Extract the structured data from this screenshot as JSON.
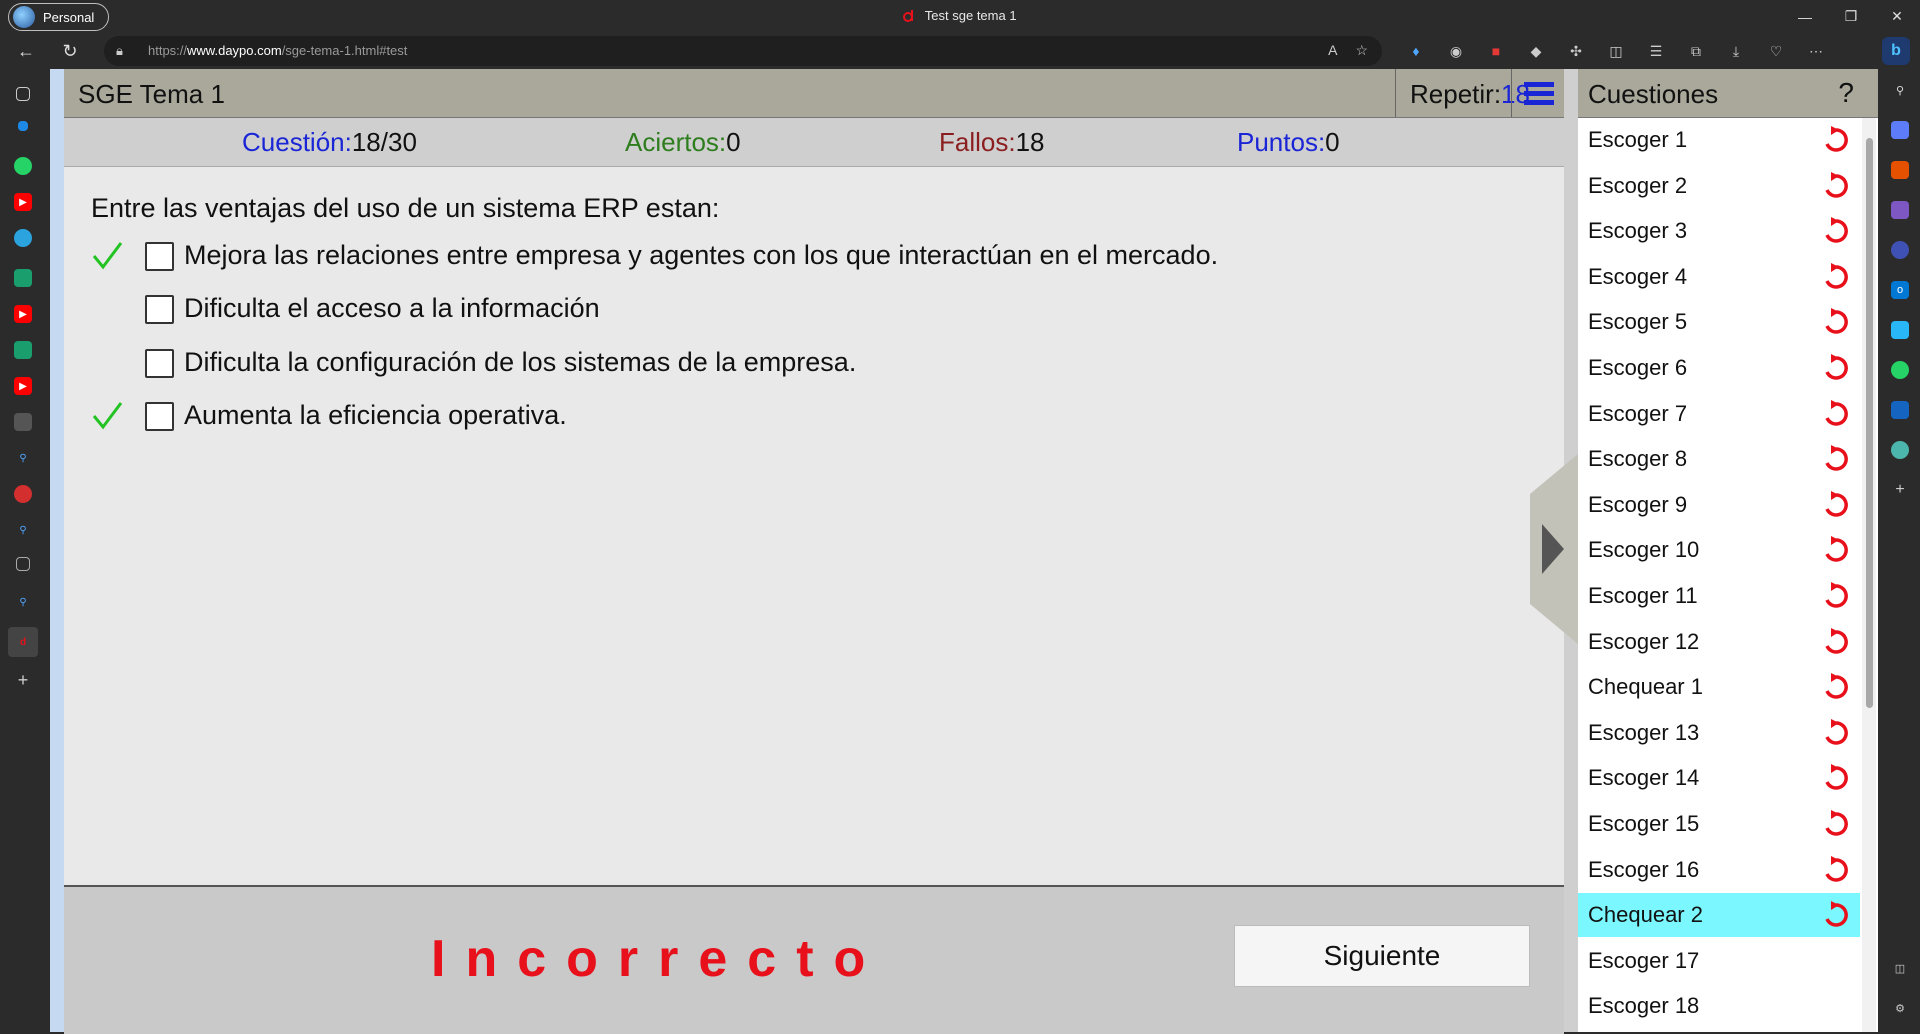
{
  "browser": {
    "profile_label": "Personal",
    "window_title": "Test sge tema 1",
    "url_prefix": "https://",
    "url_domain": "www.daypo.com",
    "url_path": "/sge-tema-1.html#test"
  },
  "header": {
    "title": "SGE Tema 1",
    "repeat_label": "Repetir:",
    "repeat_value": "18"
  },
  "stats": {
    "question_label": "Cuestión:",
    "question_value": "18/30",
    "correct_label": "Aciertos:",
    "correct_value": "0",
    "wrong_label": "Fallos:",
    "wrong_value": "18",
    "points_label": "Puntos:",
    "points_value": "0"
  },
  "question": {
    "text": "Entre las ventajas del uso de un sistema ERP estan:",
    "options": [
      {
        "text": "Mejora las relaciones entre empresa y agentes con los que interactúan en el mercado.",
        "correct_mark": true,
        "checked": false
      },
      {
        "text": "Dificulta el acceso a la información",
        "correct_mark": false,
        "checked": false
      },
      {
        "text": "Dificulta la configuración de los sistemas de la empresa.",
        "correct_mark": false,
        "checked": false
      },
      {
        "text": "Aumenta la eficiencia operativa.",
        "correct_mark": true,
        "checked": false
      }
    ]
  },
  "footer": {
    "result": "Incorrecto",
    "next_label": "Siguiente"
  },
  "questions_panel": {
    "title": "Cuestiones",
    "help": "?",
    "items": [
      {
        "label": "Escoger 1",
        "retry": true,
        "selected": false
      },
      {
        "label": "Escoger 2",
        "retry": true,
        "selected": false
      },
      {
        "label": "Escoger 3",
        "retry": true,
        "selected": false
      },
      {
        "label": "Escoger 4",
        "retry": true,
        "selected": false
      },
      {
        "label": "Escoger 5",
        "retry": true,
        "selected": false
      },
      {
        "label": "Escoger 6",
        "retry": true,
        "selected": false
      },
      {
        "label": "Escoger 7",
        "retry": true,
        "selected": false
      },
      {
        "label": "Escoger 8",
        "retry": true,
        "selected": false
      },
      {
        "label": "Escoger 9",
        "retry": true,
        "selected": false
      },
      {
        "label": "Escoger 10",
        "retry": true,
        "selected": false
      },
      {
        "label": "Escoger 11",
        "retry": true,
        "selected": false
      },
      {
        "label": "Escoger 12",
        "retry": true,
        "selected": false
      },
      {
        "label": "Chequear 1",
        "retry": true,
        "selected": false
      },
      {
        "label": "Escoger 13",
        "retry": true,
        "selected": false
      },
      {
        "label": "Escoger 14",
        "retry": true,
        "selected": false
      },
      {
        "label": "Escoger 15",
        "retry": true,
        "selected": false
      },
      {
        "label": "Escoger 16",
        "retry": true,
        "selected": false
      },
      {
        "label": "Chequear 2",
        "retry": true,
        "selected": true
      },
      {
        "label": "Escoger 17",
        "retry": false,
        "selected": false
      },
      {
        "label": "Escoger 18",
        "retry": false,
        "selected": false
      }
    ]
  },
  "colors": {
    "accent_blue": "#1a25d6",
    "correct_green": "#2e7d1e",
    "wrong_red": "#8b1e1e",
    "result_red": "#e8101a",
    "selected_item": "#7bf8ff",
    "retry_icon": "#e8101a"
  }
}
